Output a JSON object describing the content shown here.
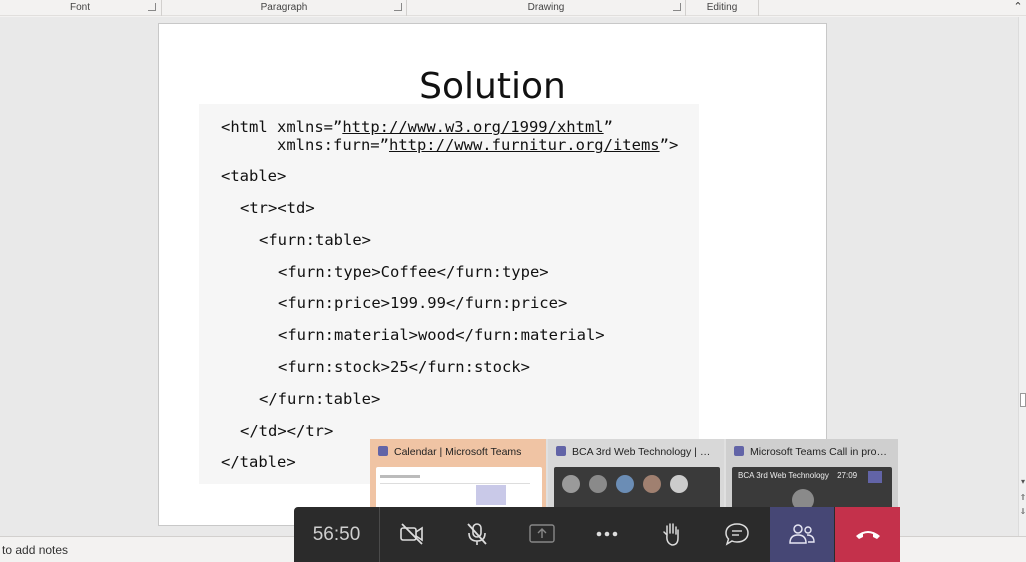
{
  "ribbon": {
    "groups": [
      {
        "label": "Font"
      },
      {
        "label": "Paragraph"
      },
      {
        "label": "Drawing"
      },
      {
        "label": "Editing"
      }
    ]
  },
  "slide": {
    "title": "Solution",
    "code_lines": [
      "<html xmlns=”http://www.w3.org/1999/xhtml”",
      "      xmlns:furn=”http://www.furnitur.org/items”>",
      "<table>",
      "<tr><td>",
      "<furn:table>",
      "<furn:type>Coffee</furn:type>",
      "<furn:price>199.99</furn:price>",
      "<furn:material>wood</furn:material>",
      "<furn:stock>25</furn:stock>",
      "</furn:table>",
      "</td></tr>",
      "</table>"
    ]
  },
  "status": {
    "notes_label": "to add notes"
  },
  "taskbar_thumbnails": [
    {
      "title": "Calendar | Microsoft Teams",
      "color": "#f0c4a4"
    },
    {
      "title": "BCA 3rd Web Technology | Micr...",
      "color": "#d8d8d8"
    },
    {
      "title": "Microsoft Teams Call in progr...",
      "color": "#cfcfcf"
    }
  ],
  "thumb3_preview": {
    "meeting_title": "BCA 3rd Web Technology",
    "time": "27:09"
  },
  "call": {
    "timer": "56:50",
    "buttons": [
      {
        "name": "camera-off-button",
        "icon": "camera-off-icon"
      },
      {
        "name": "mic-off-button",
        "icon": "mic-off-icon"
      },
      {
        "name": "share-screen-button",
        "icon": "share-icon"
      },
      {
        "name": "more-options-button",
        "icon": "ellipsis-icon"
      },
      {
        "name": "raise-hand-button",
        "icon": "hand-icon"
      },
      {
        "name": "chat-button",
        "icon": "chat-icon"
      },
      {
        "name": "participants-button",
        "icon": "people-icon"
      },
      {
        "name": "hang-up-button",
        "icon": "phone-hangup-icon"
      }
    ],
    "colors": {
      "bar": "#2b2b2b",
      "participants": "#464775",
      "hangup": "#c4314b"
    }
  }
}
